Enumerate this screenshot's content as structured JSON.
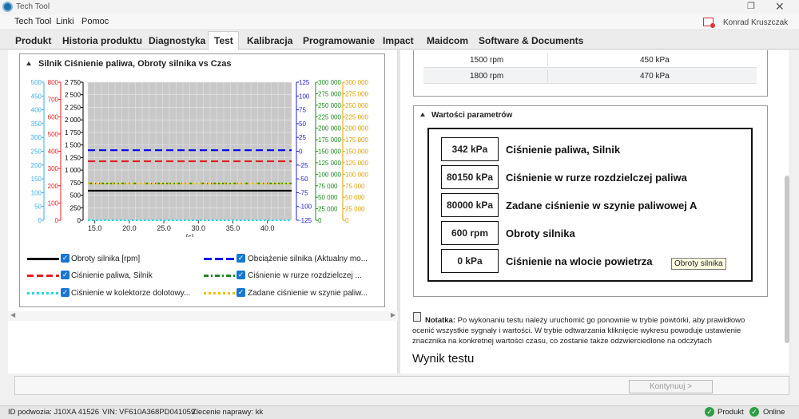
{
  "window": {
    "title": "Tech Tool",
    "maximize_icon": "restore-icon",
    "close_icon": "close-icon"
  },
  "menu": [
    {
      "label": "Tech Tool"
    },
    {
      "label": "Linki"
    },
    {
      "label": "Pomoc"
    }
  ],
  "user": {
    "name": "Konrad Kruszczak",
    "icon": "user-alert-icon"
  },
  "tabs": [
    {
      "label": "Produkt"
    },
    {
      "label": "Historia produktu"
    },
    {
      "label": "Diagnostyka"
    },
    {
      "label": "Test",
      "active": true
    },
    {
      "label": "Kalibracja"
    },
    {
      "label": "Programowanie"
    },
    {
      "label": "Impact"
    },
    {
      "label": "Maidcom"
    },
    {
      "label": "Software & Documents"
    }
  ],
  "chart": {
    "title": "Silnik Ciśnienie paliwa, Obroty silnika vs Czas",
    "x_unit": "[s]",
    "legend": [
      {
        "label": "Obroty silnika [rpm]",
        "color": "#000000",
        "style": "solid"
      },
      {
        "label": "Obciążenie silnika (Aktualny mo...",
        "color": "#0000ee",
        "style": "dashed"
      },
      {
        "label": "Ciśnienie paliwa, Silnik",
        "color": "#e02020",
        "style": "dashed"
      },
      {
        "label": "Ciśnienie w rurze rozdzielczej ...",
        "color": "#1e8a1e",
        "style": "dashdot"
      },
      {
        "label": "Ciśnienie w kolektorze dolotowy...",
        "color": "#20d8e0",
        "style": "dotted"
      },
      {
        "label": "Zadane ciśnienie w szynie paliw...",
        "color": "#f0c000",
        "style": "dotted"
      }
    ]
  },
  "chart_data": {
    "type": "line",
    "title": "Silnik Ciśnienie paliwa, Obroty silnika vs Czas",
    "xlabel": "[s]",
    "x_ticks": [
      "15.0",
      "20.0",
      "25.0",
      "30.0",
      "35.0",
      "40.0"
    ],
    "xlim": [
      14,
      43.5
    ],
    "grid": true,
    "axes": [
      {
        "id": "a1",
        "color": "#3aaee8",
        "ticks": [
          "500",
          "450",
          "400",
          "350",
          "300",
          "250",
          "200",
          "150",
          "100",
          "50",
          "0"
        ],
        "ylim": [
          0,
          500
        ]
      },
      {
        "id": "a2",
        "color": "#e02020",
        "ticks": [
          "800",
          "700",
          "600",
          "500",
          "400",
          "300",
          "200",
          "100",
          "0"
        ],
        "ylim": [
          0,
          800
        ]
      },
      {
        "id": "a3",
        "color": "#000000",
        "ticks": [
          "2 750",
          "2 500",
          "2 250",
          "2 000",
          "1 750",
          "1 500",
          "1 250",
          "1 000",
          "750",
          "500",
          "250",
          "0"
        ],
        "ylim": [
          0,
          2800
        ]
      },
      {
        "id": "a4",
        "color": "#2020cc",
        "ticks": [
          "125",
          "100",
          "75",
          "50",
          "25",
          "0",
          "-25",
          "-50",
          "-75",
          "-100",
          "-125"
        ],
        "ylim": [
          -130,
          130
        ]
      },
      {
        "id": "a5",
        "color": "#1e8a1e",
        "ticks": [
          "300 000",
          "275 000",
          "250 000",
          "225 000",
          "200 000",
          "175 000",
          "150 000",
          "125 000",
          "100 000",
          "75 000",
          "50 000",
          "25 000",
          "0"
        ],
        "ylim": [
          0,
          300000
        ]
      },
      {
        "id": "a6",
        "color": "#e0a000",
        "ticks": [
          "300 000",
          "275 000",
          "250 000",
          "225 000",
          "200 000",
          "175 000",
          "150 000",
          "125 000",
          "100 000",
          "75 000",
          "50 000",
          "25 000",
          "0"
        ],
        "ylim": [
          0,
          300000
        ]
      }
    ],
    "series": [
      {
        "name": "Obroty silnika [rpm]",
        "axis": "a3",
        "x": [
          14,
          43.5
        ],
        "y": [
          600,
          600
        ]
      },
      {
        "name": "Obciążenie silnika (Aktualny mo...",
        "axis": "a4",
        "x": [
          14,
          43.5
        ],
        "y": [
          2,
          2
        ]
      },
      {
        "name": "Ciśnienie paliwa, Silnik",
        "axis": "a2",
        "x": [
          14,
          43.5
        ],
        "y": [
          342,
          342
        ]
      },
      {
        "name": "Ciśnienie w rurze rozdzielczej ...",
        "axis": "a5",
        "x": [
          14,
          43.5
        ],
        "y": [
          80150,
          80150
        ]
      },
      {
        "name": "Ciśnienie w kolektorze dolotowy...",
        "axis": "a1",
        "x": [
          14,
          43.5
        ],
        "y": [
          0,
          0
        ]
      },
      {
        "name": "Zadane ciśnienie w szynie paliw...",
        "axis": "a6",
        "x": [
          14,
          43.5
        ],
        "y": [
          80000,
          80000
        ]
      }
    ]
  },
  "rpm_table": [
    {
      "rpm": "1500 rpm",
      "pressure": "450 kPa"
    },
    {
      "rpm": "1800 rpm",
      "pressure": "470 kPa"
    }
  ],
  "params": {
    "title": "Wartości parametrów",
    "items": [
      {
        "value": "342 kPa",
        "label": "Ciśnienie paliwa, Silnik"
      },
      {
        "value": "80150 kPa",
        "label": "Ciśnienie w rurze rozdzielczej paliwa"
      },
      {
        "value": "80000 kPa",
        "label": "Zadane ciśnienie w szynie paliwowej A"
      },
      {
        "value": "600 rpm",
        "label": "Obroty silnika"
      },
      {
        "value": "0 kPa",
        "label": "Ciśnienie na wlocie powietrza"
      }
    ],
    "tooltip": "Obroty silnika"
  },
  "note": {
    "bold": "Notatka:",
    "text": " Po wykonaniu testu należy uruchomić go ponownie w trybie powtórki, aby prawidłowo ocenić wszystkie sygnały i wartości. W trybie odtwarzania kliknięcie wykresu powoduje ustawienie znacznika na konkretnej wartości czasu, co zostanie także odzwierciedlone na odczytach",
    "icon": "note-icon"
  },
  "result": {
    "title": "Wynik testu"
  },
  "continue": {
    "label": "Kontynuuj >"
  },
  "status": {
    "id": "ID podwozia: J10XA 41526",
    "vin": "VIN: VF610A368PD041059",
    "order": "Zlecenie naprawy: kk",
    "product": "Produkt",
    "online": "Online"
  }
}
